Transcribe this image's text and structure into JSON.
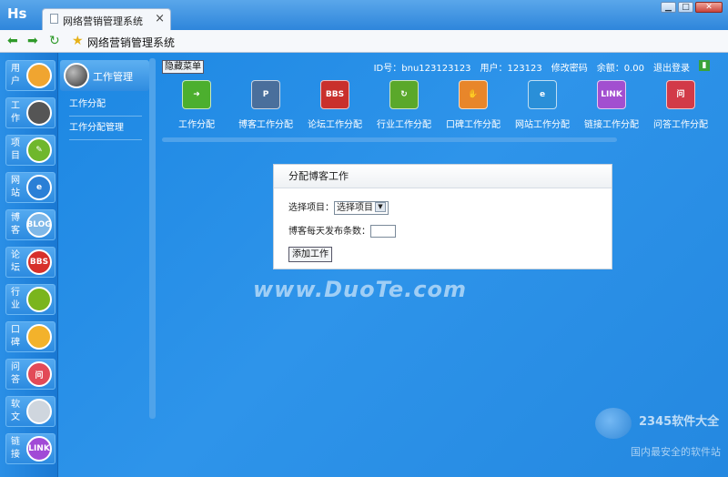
{
  "browser": {
    "app_logo": "Hs",
    "tab_title": "网络营销管理系统",
    "tab_close": "×",
    "page_title": "网络营销管理系统",
    "win_min": "▁",
    "win_max": "□",
    "win_close": "✕"
  },
  "sidebar": {
    "items": [
      {
        "label": "用户",
        "icon": "user-icon",
        "glyph": "",
        "color": "#f0a530"
      },
      {
        "label": "工作",
        "icon": "work-icon",
        "glyph": "",
        "color": "#555555"
      },
      {
        "label": "项目",
        "icon": "project-icon",
        "glyph": "✎",
        "color": "#6fb72c"
      },
      {
        "label": "网站",
        "icon": "ie-icon",
        "glyph": "e",
        "color": "#2a7fd6"
      },
      {
        "label": "博客",
        "icon": "blog-icon",
        "glyph": "BLOG",
        "color": "#7fb8e8"
      },
      {
        "label": "论坛",
        "icon": "bbs-icon",
        "glyph": "BBS",
        "color": "#d7302a"
      },
      {
        "label": "行业",
        "icon": "industry-icon",
        "glyph": "",
        "color": "#7ab51d"
      },
      {
        "label": "口碑",
        "icon": "thumb-icon",
        "glyph": "",
        "color": "#f3b22b"
      },
      {
        "label": "问答",
        "icon": "qa-icon",
        "glyph": "问",
        "color": "#e24a57"
      },
      {
        "label": "软文",
        "icon": "article-icon",
        "glyph": "",
        "color": "#cfd6de"
      },
      {
        "label": "链接",
        "icon": "link-icon",
        "glyph": "LINK",
        "color": "#a14bd6"
      }
    ]
  },
  "submenu": {
    "title": "工作管理",
    "items": [
      "工作分配",
      "工作分配管理"
    ]
  },
  "topbar": {
    "hide_menu": "隐藏菜单",
    "id_text": "ID号：bnu123123123",
    "user_text": "用户：123123",
    "change_password": "修改密码",
    "balance": "余额：0.00",
    "logout": "退出登录"
  },
  "toolbar": [
    {
      "label": "工作分配",
      "icon": "arrow-right-icon",
      "glyph": "➜",
      "color": "#4caf2e"
    },
    {
      "label": "博客工作分配",
      "icon": "blog-work-icon",
      "glyph": "P",
      "color": "#4a6f9c"
    },
    {
      "label": "论坛工作分配",
      "icon": "bbs-work-icon",
      "glyph": "BBS",
      "color": "#c9302c"
    },
    {
      "label": "行业工作分配",
      "icon": "industry-work-icon",
      "glyph": "↻",
      "color": "#5aa82a"
    },
    {
      "label": "口碑工作分配",
      "icon": "thumb-work-icon",
      "glyph": "✋",
      "color": "#e8862a"
    },
    {
      "label": "网站工作分配",
      "icon": "site-work-icon",
      "glyph": "e",
      "color": "#2a8fd8"
    },
    {
      "label": "链接工作分配",
      "icon": "link-work-icon",
      "glyph": "LINK",
      "color": "#a24fd0"
    },
    {
      "label": "问答工作分配",
      "icon": "qa-work-icon",
      "glyph": "问",
      "color": "#d23a48"
    }
  ],
  "form": {
    "title": "分配博客工作",
    "select_label": "选择项目：",
    "select_value": "选择项目",
    "daily_label": "博客每天发布条数：",
    "daily_value": "",
    "submit_label": "添加工作"
  },
  "watermarks": {
    "duote": "www.DuoTe.com",
    "brand": "2345软件大全",
    "slogan": "国内最安全的软件站"
  }
}
